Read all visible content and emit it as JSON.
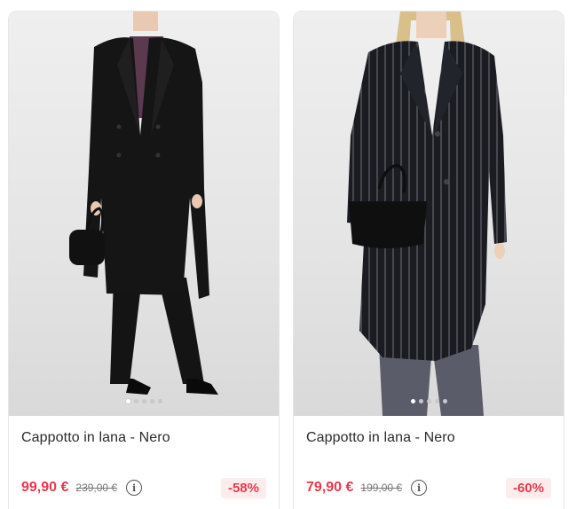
{
  "products": [
    {
      "title": "Cappotto in lana - Nero",
      "price": "99,90 €",
      "old_price": "239,00 €",
      "discount": "-58%",
      "image_count": 5,
      "active_image": 0,
      "image_alt": "model-wearing-black-wool-coat"
    },
    {
      "title": "Cappotto in lana - Nero",
      "price": "79,90 €",
      "old_price": "199,00 €",
      "discount": "-60%",
      "image_count": 5,
      "active_image": 0,
      "image_alt": "model-wearing-pinstripe-wool-coat"
    }
  ],
  "icons": {
    "info": "info-icon"
  },
  "colors": {
    "sale_price": "#e8394a",
    "discount_bg": "#fdecec"
  }
}
